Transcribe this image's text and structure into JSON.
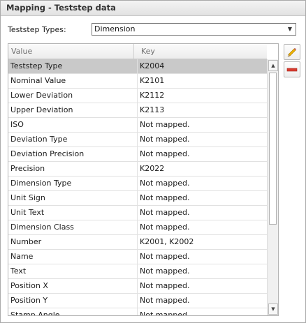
{
  "panel": {
    "title": "Mapping - Teststep data"
  },
  "teststep_types": {
    "label": "Teststep Types:",
    "selected": "Dimension"
  },
  "icons": {
    "dropdown": "chevron-down-icon",
    "edit": "pencil-icon",
    "remove": "minus-icon",
    "scroll_up": "arrow-up-icon",
    "scroll_down": "arrow-down-icon"
  },
  "colors": {
    "selected_row": "#c9c9c9",
    "pencil": "#f0b400",
    "remove": "#d83b2f"
  },
  "grid": {
    "columns": [
      "Value",
      "Key"
    ],
    "rows": [
      {
        "value": "Teststep Type",
        "key": "K2004"
      },
      {
        "value": "Nominal Value",
        "key": "K2101"
      },
      {
        "value": "Lower Deviation",
        "key": "K2112"
      },
      {
        "value": "Upper Deviation",
        "key": "K2113"
      },
      {
        "value": "ISO",
        "key": "Not mapped."
      },
      {
        "value": "Deviation Type",
        "key": "Not mapped."
      },
      {
        "value": "Deviation Precision",
        "key": "Not mapped."
      },
      {
        "value": "Precision",
        "key": "K2022"
      },
      {
        "value": "Dimension Type",
        "key": "Not mapped."
      },
      {
        "value": "Unit Sign",
        "key": "Not mapped."
      },
      {
        "value": "Unit Text",
        "key": "Not mapped."
      },
      {
        "value": "Dimension Class",
        "key": "Not mapped."
      },
      {
        "value": "Number",
        "key": "K2001, K2002"
      },
      {
        "value": "Name",
        "key": "Not mapped."
      },
      {
        "value": "Text",
        "key": "Not mapped."
      },
      {
        "value": "Position X",
        "key": "Not mapped."
      },
      {
        "value": "Position Y",
        "key": "Not mapped."
      },
      {
        "value": "Stamp Angle",
        "key": "Not mapped."
      }
    ]
  }
}
